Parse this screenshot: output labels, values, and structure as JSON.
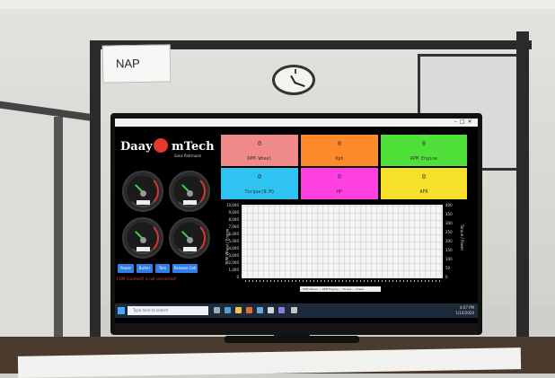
{
  "room": {
    "note_label": "NAP"
  },
  "window": {
    "title": "",
    "controls": "–□✕"
  },
  "app": {
    "logo_left": "Daay",
    "logo_right": "mTech",
    "logo_sub": "Sanz Patrmann"
  },
  "gauges": [
    {
      "label": "RPM Wheel",
      "value": 0
    },
    {
      "label": "Kph",
      "value": 0
    },
    {
      "label": "Torque",
      "value": 0
    },
    {
      "label": "RPM Engine",
      "value": 0
    }
  ],
  "buttons": [
    "Power",
    "Butter",
    "Tare",
    "Release Cell"
  ],
  "status_text": "COM [Connect] is not connected!",
  "tiles": [
    {
      "label": "RPM Wheel",
      "value": "0",
      "color": "#f08a8a"
    },
    {
      "label": "Kph",
      "value": "0",
      "color": "#ff8a2a"
    },
    {
      "label": "RPM Engine",
      "value": "0",
      "color": "#4fe03a"
    },
    {
      "label": "Torque(N.M)",
      "value": "0",
      "color": "#2ec3f0"
    },
    {
      "label": "HP",
      "value": "0",
      "color": "#ff3fe0"
    },
    {
      "label": "AFR",
      "value": "0",
      "color": "#f7e02a"
    }
  ],
  "chart": {
    "y_ticks": [
      "10,000",
      "9,000",
      "8,000",
      "7,000",
      "6,000",
      "5,000",
      "4,000",
      "3,000",
      "2,000",
      "1,000",
      "0"
    ],
    "y_ticks_right": [
      "400",
      "350",
      "300",
      "250",
      "200",
      "150",
      "100",
      "50",
      "0"
    ],
    "ylabel": "RPM Wheel / Engine",
    "ylabel_right": "Torque / Power",
    "legend": "RPM Wheel — RPM Engine — Torque — Power"
  },
  "taskbar": {
    "search_placeholder": "Type here to search",
    "clock_time": "4:07 PM",
    "clock_date": "1/14/2020"
  }
}
